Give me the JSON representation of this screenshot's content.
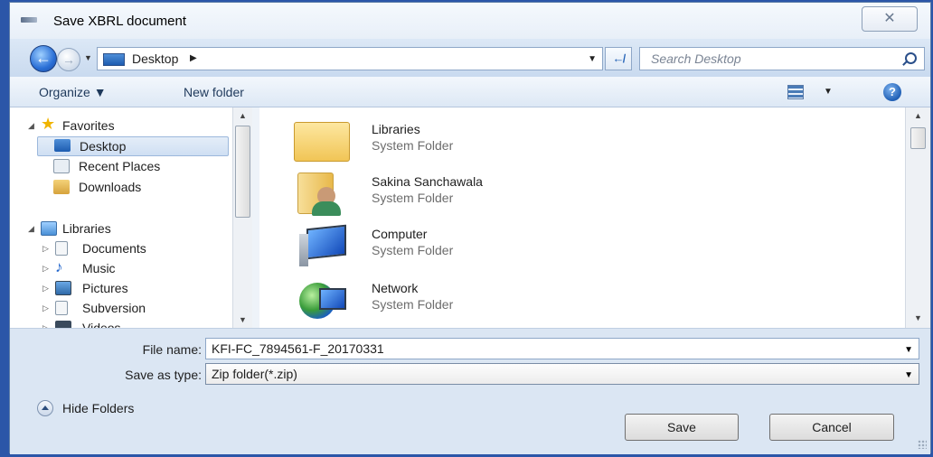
{
  "window": {
    "title": "Save XBRL document",
    "close_label": "✕"
  },
  "nav": {
    "address_crumb": "Desktop",
    "search_placeholder": "Search Desktop"
  },
  "toolbar": {
    "organize_label": "Organize ▼",
    "new_folder_label": "New folder"
  },
  "sidebar": {
    "favorites_header": "Favorites",
    "favorites": [
      {
        "label": "Desktop",
        "selected": true
      },
      {
        "label": "Recent Places"
      },
      {
        "label": "Downloads"
      }
    ],
    "libraries_header": "Libraries",
    "libraries": [
      {
        "label": "Documents"
      },
      {
        "label": "Music"
      },
      {
        "label": "Pictures"
      },
      {
        "label": "Subversion"
      },
      {
        "label": "Videos"
      }
    ]
  },
  "files": [
    {
      "name": "Libraries",
      "type": "System Folder",
      "icon": "libraries-folder-icon"
    },
    {
      "name": "Sakina Sanchawala",
      "type": "System Folder",
      "icon": "user-folder-icon"
    },
    {
      "name": "Computer",
      "type": "System Folder",
      "icon": "computer-icon"
    },
    {
      "name": "Network",
      "type": "System Folder",
      "icon": "network-icon"
    }
  ],
  "form": {
    "file_name_label": "File name:",
    "file_name_value": "KFI-FC_7894561-F_20170331",
    "save_type_label": "Save as type:",
    "save_type_value": "Zip folder(*.zip)"
  },
  "footer": {
    "hide_folders_label": "Hide Folders",
    "save_label": "Save",
    "cancel_label": "Cancel"
  },
  "colors": {
    "accent": "#2b56a8",
    "selection": "#cfdff3",
    "chrome": "#dbe6f3"
  }
}
